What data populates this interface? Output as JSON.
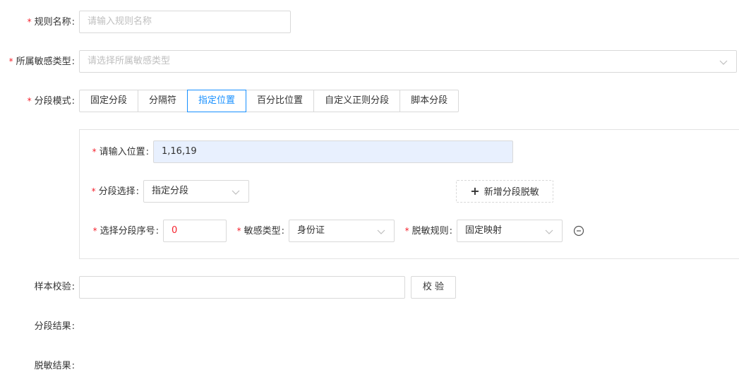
{
  "rule_name": {
    "label": "规则名称",
    "placeholder": "请输入规则名称"
  },
  "sensitive_category": {
    "label": "所属敏感类型",
    "placeholder": "请选择所属敏感类型"
  },
  "segment_mode": {
    "label": "分段模式",
    "options": [
      "固定分段",
      "分隔符",
      "指定位置",
      "百分比位置",
      "自定义正则分段",
      "脚本分段"
    ],
    "active_index": 2
  },
  "position": {
    "label": "请输入位置",
    "value": "1,16,19"
  },
  "segment_select": {
    "label": "分段选择",
    "value": "指定分段"
  },
  "add_button": {
    "label": "新增分段脱敏"
  },
  "segment_index": {
    "label": "选择分段序号",
    "value": "0"
  },
  "sensitive_type": {
    "label": "敏感类型",
    "value": "身份证"
  },
  "mask_rule": {
    "label": "脱敏规则",
    "value": "固定映射"
  },
  "sample_check": {
    "label": "样本校验",
    "value": "",
    "button": "校 验"
  },
  "segment_result": {
    "label": "分段结果"
  },
  "mask_result": {
    "label": "脱敏结果"
  },
  "colors": {
    "required": "#f5222d",
    "accent": "#1890ff",
    "highlight_input_bg": "#e8f0fe",
    "error_text": "#f5222d"
  }
}
